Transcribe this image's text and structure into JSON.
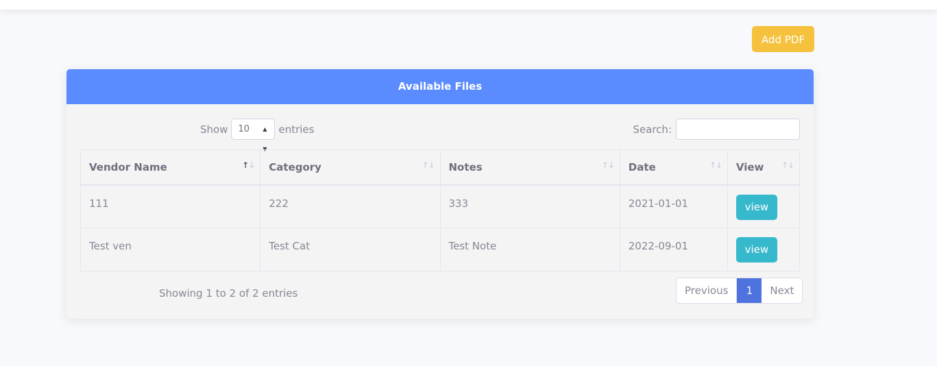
{
  "toolbar": {
    "add_pdf_label": "Add PDF"
  },
  "card": {
    "title": "Available Files",
    "length": {
      "show_label": "Show",
      "value": "10",
      "entries_label": "entries"
    },
    "search": {
      "label": "Search:",
      "value": ""
    },
    "columns": [
      "Vendor Name",
      "Category",
      "Notes",
      "Date",
      "View"
    ],
    "rows": [
      {
        "vendor": "111",
        "category": "222",
        "notes": "333",
        "date": "2021-01-01",
        "action": "view"
      },
      {
        "vendor": "Test ven",
        "category": "Test Cat",
        "notes": "Test Note",
        "date": "2022-09-01",
        "action": "view"
      }
    ],
    "info": "Showing 1 to 2 of 2 entries",
    "pagination": {
      "previous": "Previous",
      "current": "1",
      "next": "Next"
    }
  },
  "colors": {
    "header": "#5a8bff",
    "add_pdf": "#f6c23e",
    "view_button": "#36b9cc",
    "active_page": "#4e73df"
  }
}
